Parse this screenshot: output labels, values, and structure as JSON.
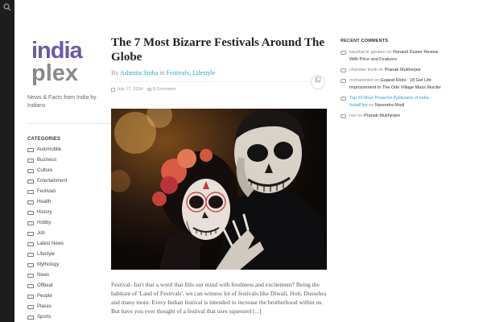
{
  "site": {
    "logo_line1": "india",
    "logo_line2": "plex",
    "tagline": "News & Facts from India by Indians",
    "brand_color": "#6c59a8",
    "accent_link_color": "#2ba3d4"
  },
  "topbar": {
    "search_icon": "search-icon"
  },
  "categories": {
    "title": "CATEGORIES",
    "items": [
      "Automobile",
      "Business",
      "Culture",
      "Entertainment",
      "Festivals",
      "Health",
      "History",
      "Hobby",
      "Job",
      "Latest News",
      "Lifestyle",
      "Mythology",
      "News",
      "Offbeat",
      "People",
      "Places",
      "Sports"
    ]
  },
  "post": {
    "title": "The 7 Most Bizarre Festivals Around The Globe",
    "by_prefix": "By",
    "author": "Ashmita Sinha",
    "in_word": "in",
    "category_1": "Festivals",
    "category_sep": ",",
    "category_2": "Lifestyle",
    "date": "July 17, 2014",
    "comments": "0 Comment",
    "excerpt": "Festival- Isn't that a word that fills our mind with freshness and excitement? Being the habitant of 'Land of Festivals', we can witness lot of festivals like Diwali, Holi, Dussehra and many more. Every Indian festival is intended to increase the brotherhood within us. But have you ever thought of a festival that uses squeezed [...]"
  },
  "recent_comments": {
    "title": "RECENT COMMENTS",
    "items": [
      {
        "author": "kaushal kr gautam",
        "on": "on",
        "post": "Renault Duster Review With Price and Features",
        "post_is_link": false
      },
      {
        "author": "chandan barik",
        "on": "on",
        "post": "Pranab Mukherjee",
        "post_is_link": false
      },
      {
        "author": "mohammed",
        "on": "on",
        "post": "Gujarat Riots : 18 Get Life Imprisonment In The Ode Village Mass Murder",
        "post_is_link": false
      },
      {
        "author": "Top 10 Most Powerful Politicians of India - IndiaPlex",
        "on": "on",
        "post": "Narendra Modi",
        "post_is_link": false,
        "author_is_link": true
      },
      {
        "author": "ravi",
        "on": "on",
        "post": "Pranab Mukherjee",
        "post_is_link": false
      }
    ]
  }
}
